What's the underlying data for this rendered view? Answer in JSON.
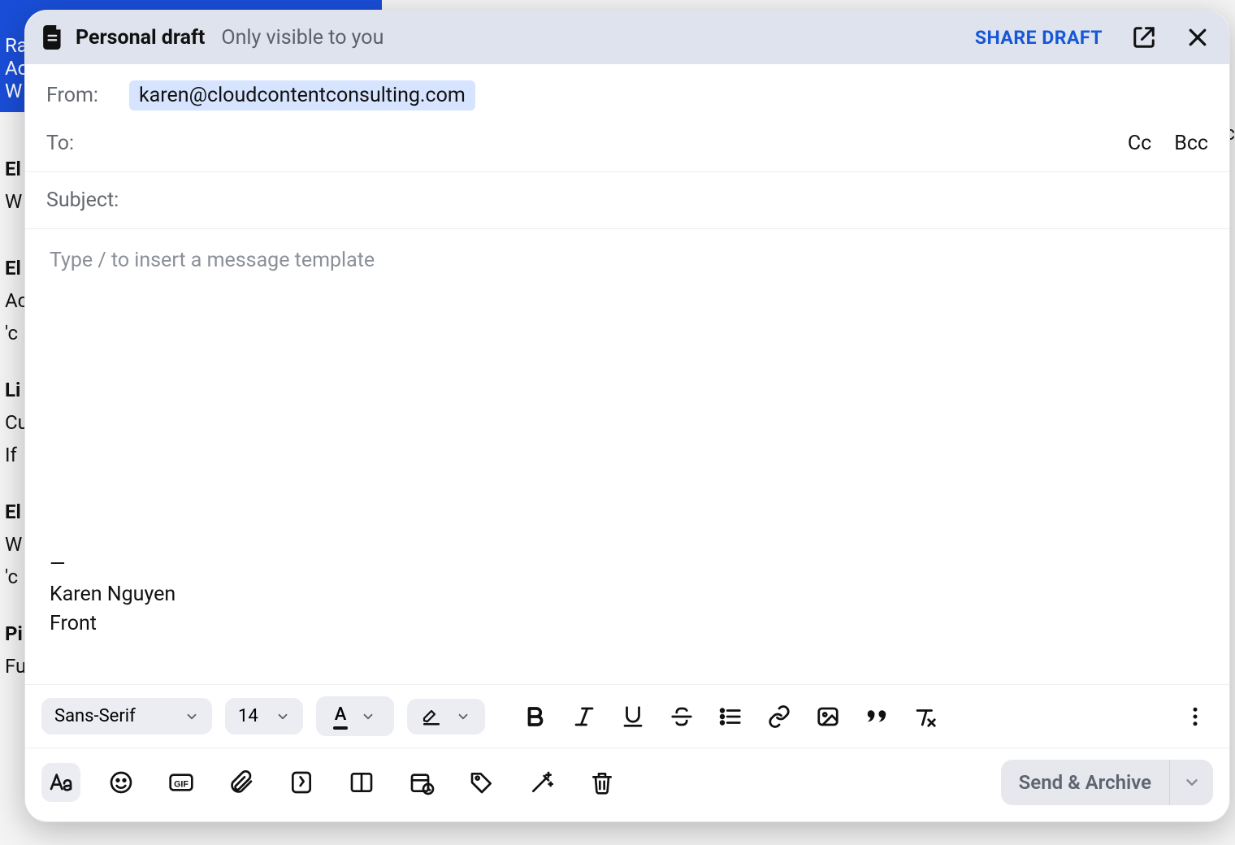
{
  "header": {
    "title": "Personal draft",
    "subtitle": "Only visible to you",
    "share_label": "SHARE DRAFT"
  },
  "compose": {
    "from_label": "From:",
    "from_value": "karen@cloudcontentconsulting.com",
    "to_label": "To:",
    "cc_label": "Cc",
    "bcc_label": "Bcc",
    "subject_label": "Subject:",
    "body_placeholder": "Type / to insert a message template",
    "signature": {
      "dash": "—",
      "name": "Karen Nguyen",
      "company": "Front"
    }
  },
  "format_toolbar": {
    "font_family": "Sans-Serif",
    "font_size": "14"
  },
  "send": {
    "label": "Send & Archive"
  },
  "background": {
    "selected_lines": [
      "Ra",
      "Ac",
      "W"
    ],
    "stubs": [
      "El",
      "W",
      "",
      "El",
      "Ac",
      "'c",
      "",
      "Li",
      "Cu",
      "If",
      "",
      "El",
      "W",
      "'c",
      "",
      "Pi",
      "Functionality test"
    ],
    "right_stub": "g.c"
  }
}
